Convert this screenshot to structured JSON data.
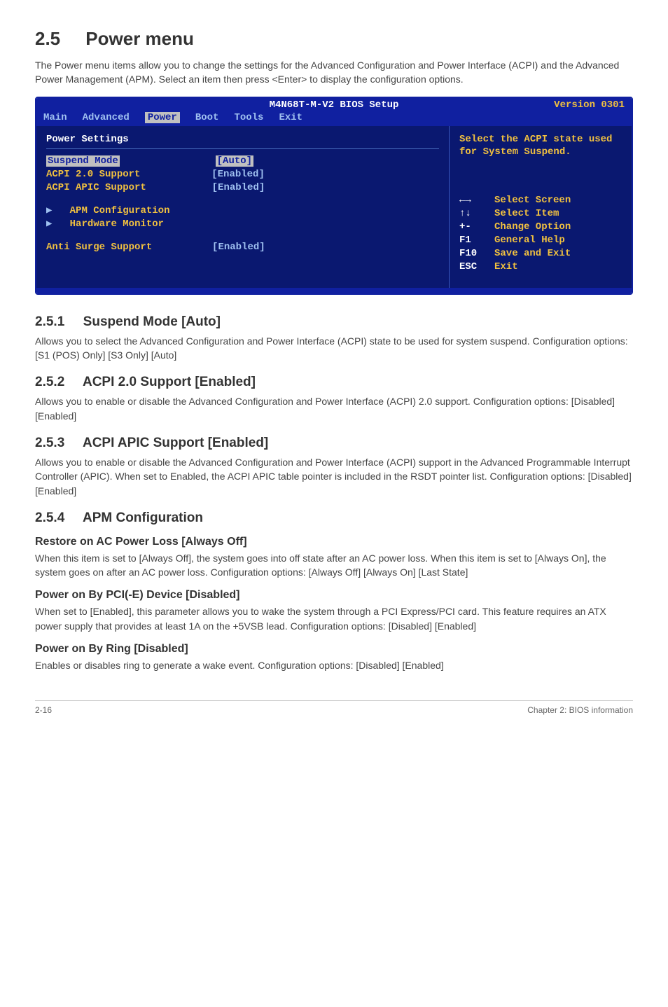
{
  "title_num": "2.5",
  "title_txt": "Power menu",
  "intro": "The Power menu items allow you to change the settings for the Advanced Configuration and Power Interface (ACPI) and the Advanced Power Management (APM). Select an item then press <Enter> to display the configuration options.",
  "bios": {
    "setup_title": "M4N68T-M-V2 BIOS Setup",
    "version": "Version 0301",
    "tabs": [
      "Main",
      "Advanced",
      "Power",
      "Boot",
      "Tools",
      "Exit"
    ],
    "settings_heading": "Power Settings",
    "items": [
      {
        "label": "Suspend Mode",
        "value": "[Auto]",
        "highlight": true
      },
      {
        "label": "ACPI 2.0 Support",
        "value": "[Enabled]"
      },
      {
        "label": "ACPI APIC Support",
        "value": "[Enabled]"
      },
      {
        "label": "APM Configuration",
        "arrow": true
      },
      {
        "label": "Hardware Monitor",
        "arrow": true
      },
      {
        "label": "Anti Surge Support",
        "value": "[Enabled]"
      }
    ],
    "help_text": "Select the ACPI state used for System Suspend.",
    "help_keys": [
      {
        "key": "←→",
        "desc": "Select Screen"
      },
      {
        "key": "↑↓",
        "desc": "Select Item"
      },
      {
        "key": "+-",
        "desc": "Change Option"
      },
      {
        "key": "F1",
        "desc": "General Help"
      },
      {
        "key": "F10",
        "desc": "Save and Exit"
      },
      {
        "key": "ESC",
        "desc": "Exit"
      }
    ]
  },
  "s251_num": "2.5.1",
  "s251_title": "Suspend Mode [Auto]",
  "s251_body": "Allows you to select the Advanced Configuration and Power Interface (ACPI) state to be used for system suspend. Configuration options: [S1 (POS) Only] [S3 Only] [Auto]",
  "s252_num": "2.5.2",
  "s252_title": "ACPI 2.0 Support [Enabled]",
  "s252_body": "Allows you to enable or disable the Advanced Configuration and Power Interface (ACPI) 2.0 support. Configuration options: [Disabled] [Enabled]",
  "s253_num": "2.5.3",
  "s253_title": "ACPI APIC Support [Enabled]",
  "s253_body": "Allows you to enable or disable the Advanced Configuration and Power Interface (ACPI) support in the Advanced Programmable Interrupt Controller (APIC). When set to Enabled, the ACPI APIC table pointer is included in the RSDT pointer list. Configuration options: [Disabled] [Enabled]",
  "s254_num": "2.5.4",
  "s254_title": "APM Configuration",
  "s254a_h": "Restore on AC Power Loss [Always Off]",
  "s254a_b": "When this item is set to [Always Off], the system goes into off state after an AC power loss. When this item is set to [Always On], the system goes on after an AC power loss. Configuration options: [Always Off] [Always On] [Last State]",
  "s254b_h": "Power on By PCI(-E) Device [Disabled]",
  "s254b_b": "When set to [Enabled], this parameter allows you to wake the system through a PCI Express/PCI card. This feature requires an ATX power supply that provides at least 1A on the +5VSB lead. Configuration options: [Disabled] [Enabled]",
  "s254c_h": "Power on By Ring [Disabled]",
  "s254c_b": "Enables or disables ring to generate a wake event. Configuration options: [Disabled] [Enabled]",
  "footer_left": "2-16",
  "footer_right": "Chapter 2: BIOS information"
}
